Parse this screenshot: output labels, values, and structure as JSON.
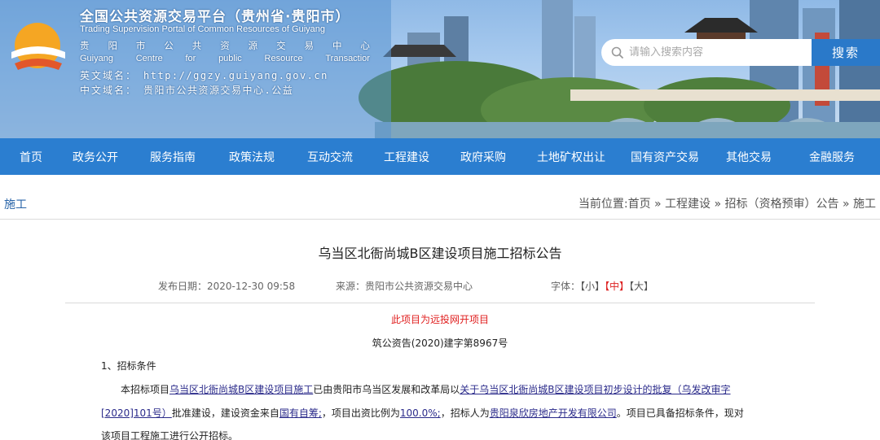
{
  "header": {
    "site_title": "全国公共资源交易平台（贵州省·贵阳市）",
    "site_title_en": "Trading Supervision Portal of Common Resources of Guiyang",
    "name_cn_chars": [
      "贵",
      "阳",
      "市",
      "公",
      "共",
      "资",
      "源",
      "交",
      "易",
      "中",
      "心"
    ],
    "name_en_words": [
      "Guiyang",
      "Centre",
      "for",
      "public",
      "Resource",
      "Transactior"
    ],
    "domain_en_label": "英文域名：",
    "domain_en_value": "http://ggzy.guiyang.gov.cn",
    "domain_cn_label": "中文域名：",
    "domain_cn_value": "贵阳市公共资源交易中心.公益",
    "logo_icon": "sunrise-logo-icon",
    "accent_color": "#2b7ed0"
  },
  "search": {
    "placeholder": "请输入搜索内容",
    "button_label": "搜索",
    "icon": "search-icon"
  },
  "nav": {
    "items": [
      "首页",
      "政务公开",
      "服务指南",
      "政策法规",
      "互动交流",
      "工程建设",
      "政府采购",
      "土地矿权出让",
      "国有资产交易",
      "其他交易",
      "金融服务"
    ]
  },
  "section": {
    "title": "施工",
    "breadcrumb": "当前位置:首页 » 工程建设 » 招标（资格预审）公告 » 施工"
  },
  "article": {
    "title": "乌当区北衙尚城B区建设项目施工招标公告",
    "date_label": "发布日期：",
    "date_value": "2020-12-30 09:58",
    "source_label": "来源：",
    "source_value": "贵阳市公共资源交易中心",
    "font_label": "字体：",
    "font_small": "【小】",
    "font_medium": "【中】",
    "font_large": "【大】",
    "remote_notice": "此项目为远投网开项目",
    "doc_number": "筑公资告(2020)建字第8967号",
    "section1_heading": "1、招标条件",
    "p1_a": "本招标项目",
    "p1_project": "乌当区北衙尚城B区建设项目施工",
    "p1_b": "已由贵阳市乌当区发展和改革局以",
    "p1_approval": "关于乌当区北衙尚城B区建设项目初步设计的批复（乌发改审字",
    "p2_approval_end": "[2020]101号）",
    "p2_a": "批准建设，建设资金来自",
    "p2_fund": "国有自筹;",
    "p2_b": "，项目出资比例为",
    "p2_ratio": "100.0%;",
    "p2_c": "，招标人为",
    "p2_owner": "贵阳泉欣房地产开发有限公司",
    "p2_d": "。项目已具备招标条件，现对",
    "p3": "该项目工程施工进行公开招标。"
  }
}
